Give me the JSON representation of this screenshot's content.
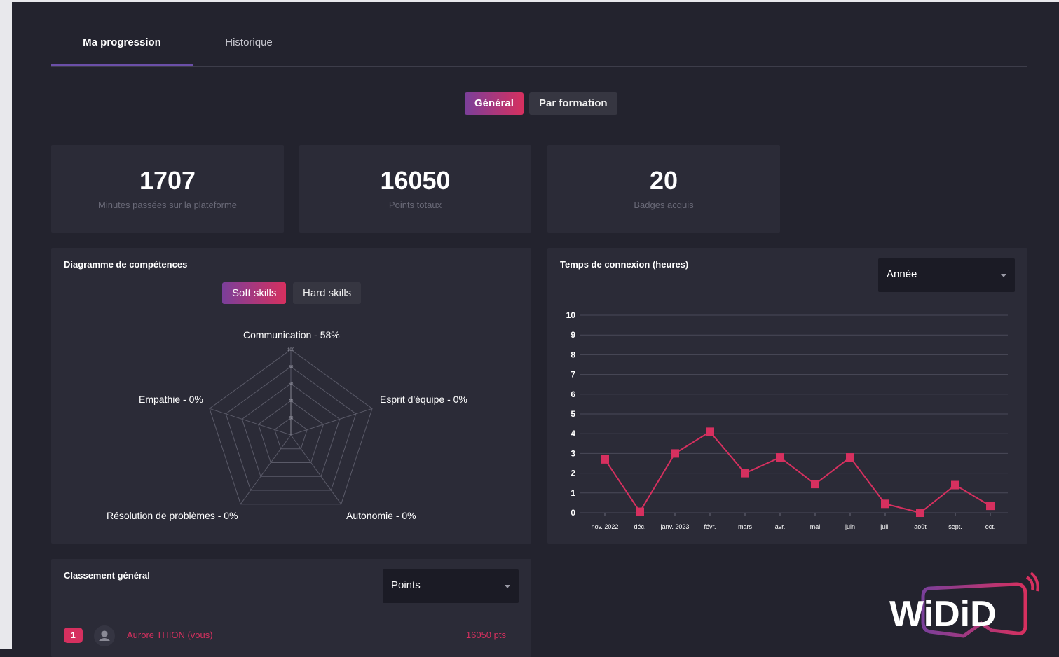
{
  "tabs": [
    {
      "label": "Ma progression",
      "active": true
    },
    {
      "label": "Historique",
      "active": false
    }
  ],
  "view_toggle": {
    "general": "Général",
    "by_course": "Par formation",
    "selected": "Général"
  },
  "stats": [
    {
      "value": "1707",
      "label": "Minutes passées sur la plateforme"
    },
    {
      "value": "16050",
      "label": "Points totaux"
    },
    {
      "value": "20",
      "label": "Badges acquis"
    }
  ],
  "skills_card": {
    "title": "Diagramme de compétences",
    "toggle": {
      "soft": "Soft skills",
      "hard": "Hard skills",
      "selected": "Soft skills"
    },
    "axes": [
      {
        "label": "Communication - 58%",
        "value": 58
      },
      {
        "label": "Esprit d'équipe - 0%",
        "value": 0
      },
      {
        "label": "Autonomie - 0%",
        "value": 0
      },
      {
        "label": "Résolution de problèmes - 0%",
        "value": 0
      },
      {
        "label": "Empathie - 0%",
        "value": 0
      }
    ],
    "rings": [
      "20",
      "40",
      "60",
      "80",
      "100"
    ]
  },
  "connection_card": {
    "title": "Temps de connexion (heures)",
    "period_select": "Année"
  },
  "ranking_card": {
    "title": "Classement général",
    "sort_select": "Points",
    "rows": [
      {
        "rank": "1",
        "name": "Aurore THION (vous)",
        "points": "16050 pts"
      }
    ]
  },
  "logo": {
    "text": "WiDiD",
    "colors": [
      "#ffffff",
      "#7a3f9a",
      "#d6305f"
    ]
  },
  "colors": {
    "accent": "#d6305f",
    "accent_purple": "#7a3f9a",
    "background": "#23232e",
    "card": "#2b2b37"
  },
  "chart_data": {
    "type": "line",
    "title": "",
    "categories": [
      "nov. 2022",
      "déc.",
      "janv. 2023",
      "févr.",
      "mars",
      "avr.",
      "mai",
      "juin",
      "juil.",
      "août",
      "sept.",
      "oct."
    ],
    "series": [
      {
        "values": [
          2.7,
          0.05,
          3.0,
          4.1,
          2.0,
          2.8,
          1.45,
          2.8,
          0.45,
          0.0,
          1.4,
          0.35
        ]
      }
    ],
    "yticks": [
      "0",
      "1",
      "2",
      "3",
      "4",
      "5",
      "6",
      "7",
      "8",
      "9",
      "10"
    ],
    "ylim": [
      0,
      10
    ],
    "grid": true,
    "color": "#d6305f"
  }
}
